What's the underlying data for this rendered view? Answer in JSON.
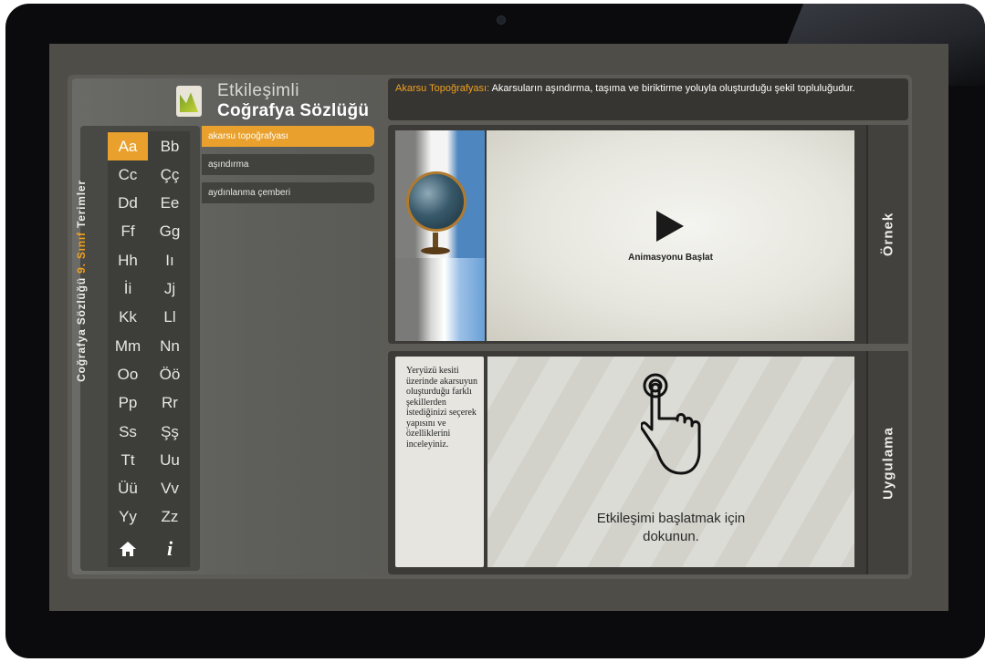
{
  "app": {
    "title_line1": "Etkileşimli",
    "title_line2": "Coğrafya Sözlüğü",
    "vertical_label_part1": "Coğrafya Sözlüğü ",
    "vertical_label_part2": "9. Sınıf",
    "vertical_label_part3": " Terimler"
  },
  "letters": [
    [
      "Aa",
      "Bb"
    ],
    [
      "Cc",
      "Çç"
    ],
    [
      "Dd",
      "Ee"
    ],
    [
      "Ff",
      "Gg"
    ],
    [
      "Hh",
      "Iı"
    ],
    [
      "İi",
      "Jj"
    ],
    [
      "Kk",
      "Ll"
    ],
    [
      "Mm",
      "Nn"
    ],
    [
      "Oo",
      "Öö"
    ],
    [
      "Pp",
      "Rr"
    ],
    [
      "Ss",
      "Şş"
    ],
    [
      "Tt",
      "Uu"
    ],
    [
      "Üü",
      "Vv"
    ],
    [
      "Yy",
      "Zz"
    ]
  ],
  "selected_letter": "Aa",
  "words": [
    "akarsu topoğrafyası",
    "aşındırma",
    "aydınlanma çemberi"
  ],
  "selected_word": "akarsu topoğrafyası",
  "definition": {
    "term": "Akarsu Topoğrafyası:",
    "text": " Akarsuların aşındırma, taşıma ve biriktirme yoluyla oluşturduğu şekil topluluğudur."
  },
  "example": {
    "side_label": "Örnek",
    "play_label": "Animasyonu Başlat"
  },
  "practice": {
    "side_label": "Uygulama",
    "instruction": "Yeryüzü kesiti üzerinde akarsuyun oluşturduğu farklı şekillerden istediğinizi seçerek yapısını ve özelliklerini inceleyiniz.",
    "touch_message_line1": "Etkileşimi başlatmak için",
    "touch_message_line2": "dokunun."
  },
  "icons": {
    "home": "home-icon",
    "info": "info-icon",
    "play": "play-icon",
    "touch": "touch-hand-icon",
    "globe": "globe-icon"
  },
  "colors": {
    "accent": "#e9a02c"
  }
}
